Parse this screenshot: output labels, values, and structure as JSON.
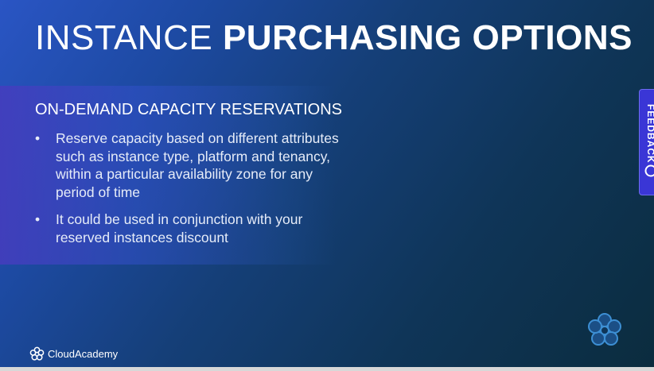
{
  "slide": {
    "title_light": "INSTANCE",
    "title_bold": "PURCHASING OPTIONS",
    "section_heading": "ON-DEMAND CAPACITY RESERVATIONS",
    "bullets": [
      "Reserve capacity based on different attributes such as instance type, platform and tenancy, within a particular availability zone for any period of time",
      "It could be used in conjunction with your reserved instances discount"
    ],
    "bullet_symbol": "•"
  },
  "feedback": {
    "label": "FEEDBACK",
    "icon": "feedback-icon",
    "color": "#3a36d6"
  },
  "branding": {
    "name": "CloudAcademy",
    "logo_icon": "cloudacademy-logo-icon",
    "mark_icon": "cloudacademy-mark-icon"
  },
  "colors": {
    "text": "#ffffff",
    "bullet_text": "#e6ecf8"
  }
}
